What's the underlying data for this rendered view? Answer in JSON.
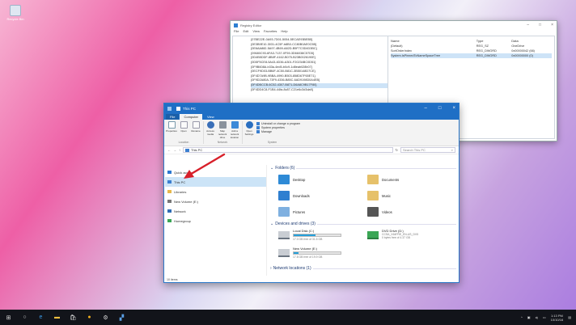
{
  "desktop": {
    "icon_label": "Recycle Bin"
  },
  "registry": {
    "title": "Registry Editor",
    "menu": [
      "File",
      "Edit",
      "View",
      "Favorites",
      "Help"
    ],
    "keys": [
      "{07BE22E-0A93-7D01-5054-5ECAE93BEB5}",
      "{0E3B9E10-3031-4C5F-b8B0-CC80B0AE0C5B}",
      "{0E6AA882-5A97-4B69-A82D-B5F7C3D4D3BC}",
      "{09680C93-6FA3-7137-0F59-3D66038C57D5}",
      "{0D4B5DDF-8B8F-4162-B075-B23B0026190E}",
      "{0D5F5CE8-5A43-4D36-A301-F20234BC0D51}",
      "{0F9B608A-b33a-4ed5-b0c9-1d8eab028b07}",
      "{0ECF9D03-BB6F-4C50-B81C-3B50148D7CE}",
      "{0F4D7A9B-9BBA-4990-B503-858D67F65E71}",
      "{0F9D2A80A-73F9-4336-B85C-6AD9198D0A4EB}",
      "{0F4DBCCB-6C52-4307-B871-D6A8C9B17F80}",
      "{0F4DD4C8-F1B4-44fa-8c87-C21e6c3d3da9}"
    ],
    "selected_key_index": 10,
    "columns": [
      "Name",
      "Type",
      "Data"
    ],
    "values": [
      [
        "(Default)",
        "REG_SZ",
        "OneDrive"
      ],
      [
        "SortOrderIndex",
        "REG_DWORD",
        "0x00000042 (66)"
      ],
      [
        "System.IsPinnedToNameSpaceTree",
        "REG_DWORD",
        "0x00000000 (0)"
      ]
    ],
    "selected_value_index": 2
  },
  "explorer": {
    "title": "This PC",
    "tabs": [
      "File",
      "Computer",
      "View"
    ],
    "ribbon": {
      "location_buttons": [
        "Properties",
        "Open",
        "Rename"
      ],
      "network_buttons": [
        "Access media",
        "Map network drive",
        "Add a network location"
      ],
      "open_settings": "Open Settings",
      "system_list": [
        "Uninstall or change a program",
        "System properties",
        "Manage"
      ],
      "groups": [
        "Location",
        "Network",
        "System"
      ]
    },
    "address": "This PC",
    "search_placeholder": "Search This PC",
    "nav": [
      "Quick access",
      "This PC",
      "Libraries",
      "New Volume (E:)",
      "Network",
      "Homegroup"
    ],
    "nav_selected": 1,
    "folders_header": "Folders (6)",
    "folders": [
      "Desktop",
      "Documents",
      "Downloads",
      "Music",
      "Pictures",
      "Videos"
    ],
    "drives_header": "Devices and drives (3)",
    "drives": [
      {
        "name": "Local Disk (C:)",
        "free": "17.0 GB free of 31.5 GB",
        "used_fraction": 0.46
      },
      {
        "name": "New Volume (E:)",
        "free": "17.8 GB free of 19.9 GB",
        "used_fraction": 0.11
      }
    ],
    "dvd": {
      "name": "DVD Drive (D:)",
      "line2": "CCSA_X64FRE_EN-US_DV5",
      "line3": "0 bytes free of 4.37 GB"
    },
    "network_header": "Network locations (1)",
    "status": "10 items"
  },
  "taskbar": {
    "time": "1:13 PM",
    "date": "10/10/16"
  }
}
